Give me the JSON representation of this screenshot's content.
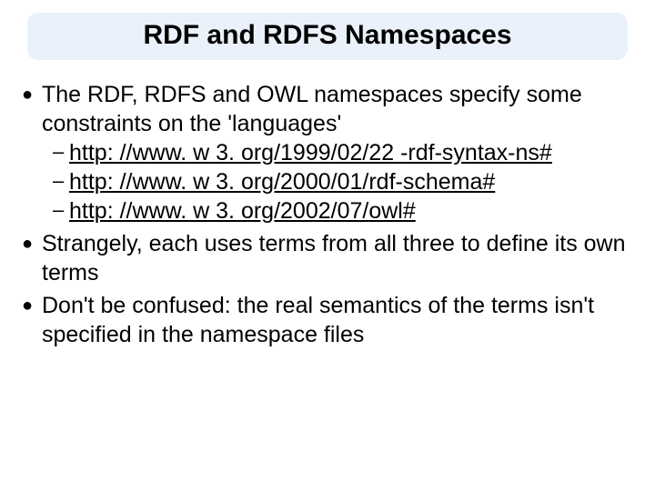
{
  "slide": {
    "title": "RDF and RDFS Namespaces",
    "bullets": [
      {
        "level": 1,
        "text": "The RDF, RDFS and OWL namespaces specify some constraints on the 'languages'"
      },
      {
        "level": 2,
        "text": "http: //www. w 3. org/1999/02/22 -rdf-syntax-ns#",
        "link": true
      },
      {
        "level": 2,
        "text": "http: //www. w 3. org/2000/01/rdf-schema#",
        "link": true
      },
      {
        "level": 2,
        "text": "http: //www. w 3. org/2002/07/owl#",
        "link": true
      },
      {
        "level": 1,
        "text": "Strangely, each uses terms from all three to define its own terms"
      },
      {
        "level": 1,
        "text": "Don't be confused: the real semantics of the terms isn't specified in the namespace files"
      }
    ]
  }
}
